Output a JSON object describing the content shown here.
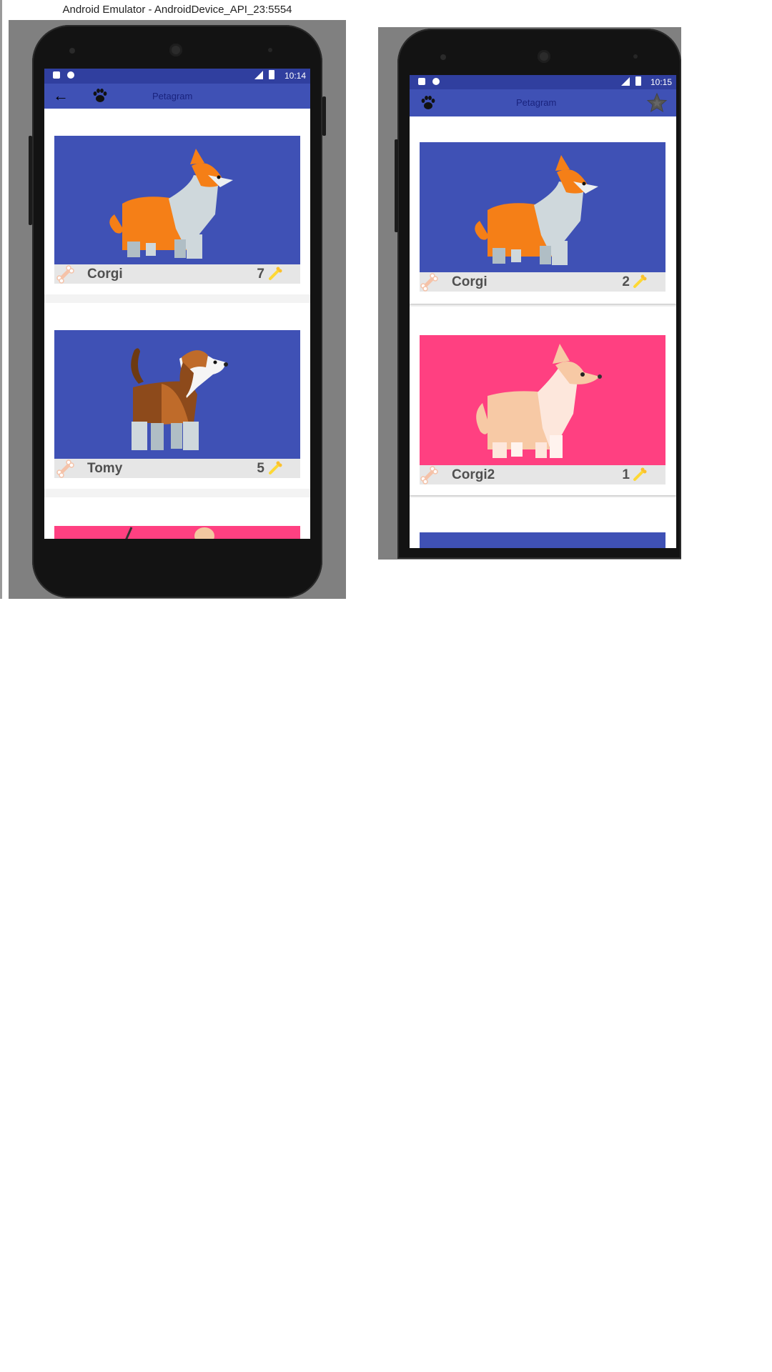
{
  "emulator": {
    "title": "Android Emulator - AndroidDevice_API_23:5554"
  },
  "app": {
    "name": "Petagram",
    "toolbar_color": "#3f51b5",
    "statusbar_color": "#303f9f",
    "card_bar_color": "#e6e6e6"
  },
  "left_screen": {
    "time": "10:14",
    "icons": [
      "back-arrow-icon",
      "paw-icon"
    ],
    "cards": [
      {
        "name": "Corgi",
        "likes": "7",
        "image_bg": "#3f51b5",
        "dog": "corgi-orange"
      },
      {
        "name": "Tomy",
        "likes": "5",
        "image_bg": "#3f51b5",
        "dog": "beagle"
      }
    ],
    "partial_card_bg": "#ff4081"
  },
  "right_screen": {
    "time": "10:15",
    "icons": [
      "paw-icon",
      "star-icon"
    ],
    "cards": [
      {
        "name": "Corgi",
        "likes": "2",
        "image_bg": "#3f51b5",
        "dog": "corgi-orange"
      },
      {
        "name": "Corgi2",
        "likes": "1",
        "image_bg": "#ff4081",
        "dog": "corgi-tan"
      }
    ],
    "partial_card_bg": "#3f51b5"
  }
}
